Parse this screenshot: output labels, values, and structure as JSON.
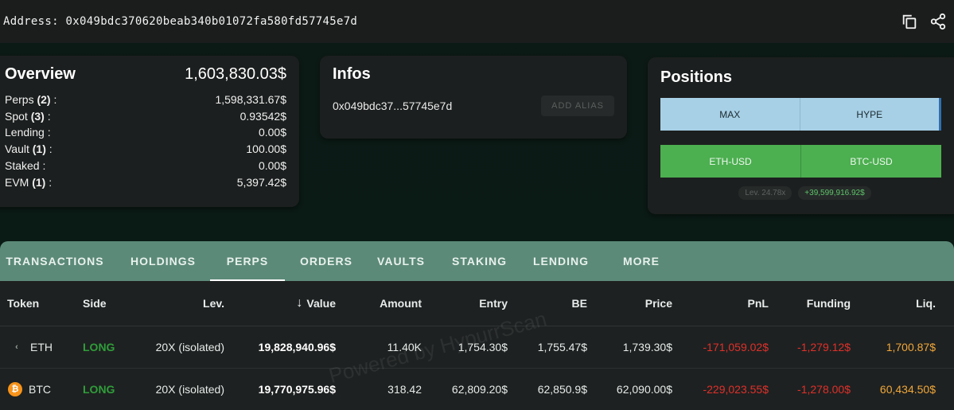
{
  "address": {
    "label": "Address: 0x049bdc370620beab340b01072fa580fd57745e7d",
    "icons": [
      "copy-icon",
      "share-icon"
    ]
  },
  "overview": {
    "title": "Overview",
    "total": "1,603,830.03$",
    "rows": [
      {
        "label": "Perps",
        "count": "(2)",
        "suffix": " :",
        "value": "1,598,331.67$"
      },
      {
        "label": "Spot",
        "count": "(3)",
        "suffix": " :",
        "value": "0.93542$"
      },
      {
        "label": "Lending :",
        "count": "",
        "suffix": "",
        "value": "0.00$"
      },
      {
        "label": "Vault",
        "count": "(1)",
        "suffix": " :",
        "value": "100.00$"
      },
      {
        "label": "Staked :",
        "count": "",
        "suffix": "",
        "value": "0.00$"
      },
      {
        "label": "EVM",
        "count": "(1)",
        "suffix": " :",
        "value": "5,397.42$"
      }
    ]
  },
  "infos": {
    "title": "Infos",
    "short_address": "0x049bdc37...57745e7d",
    "alias_button": "ADD ALIAS"
  },
  "positions": {
    "title": "Positions",
    "row1": [
      "MAX",
      "HYPE"
    ],
    "row2": [
      "ETH-USD",
      "BTC-USD"
    ],
    "leverage": "Lev. 24.78x",
    "pnl": "+39,599,916.92$"
  },
  "tabs": [
    "TRANSACTIONS",
    "HOLDINGS",
    "PERPS",
    "ORDERS",
    "VAULTS",
    "STAKING",
    "LENDING",
    "MORE"
  ],
  "active_tab": "PERPS",
  "table": {
    "headers": {
      "token": "Token",
      "side": "Side",
      "lev": "Lev.",
      "value": "Value",
      "amount": "Amount",
      "entry": "Entry",
      "be": "BE",
      "price": "Price",
      "pnl": "PnL",
      "funding": "Funding",
      "liq": "Liq."
    },
    "rows": [
      {
        "token": "ETH",
        "side": "LONG",
        "lev": "20X (isolated)",
        "value": "19,828,940.96$",
        "amount": "11.40K",
        "entry": "1,754.30$",
        "be": "1,755.47$",
        "price": "1,739.30$",
        "pnl": "-171,059.02$",
        "funding": "-1,279.12$",
        "liq": "1,700.87$"
      },
      {
        "token": "BTC",
        "side": "LONG",
        "lev": "20X (isolated)",
        "value": "19,770,975.96$",
        "amount": "318.42",
        "entry": "62,809.20$",
        "be": "62,850.9$",
        "price": "62,090.00$",
        "pnl": "-229,023.55$",
        "funding": "-1,278.00$",
        "liq": "60,434.50$"
      }
    ]
  },
  "watermark": "Powered by HypurrScan",
  "colors": {
    "accent_tab": "#5c8a79",
    "long": "#2f9d3a",
    "negative": "#e0302a",
    "liquidation": "#f0a73a",
    "position_blue": "#a7d0e6",
    "position_green": "#4caf50"
  }
}
